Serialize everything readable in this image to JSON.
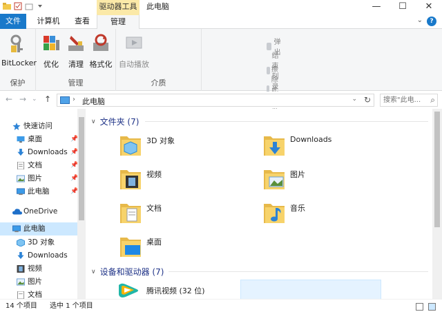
{
  "window": {
    "context_tab_header": "驱动器工具",
    "title": "此电脑",
    "controls": {
      "minimize": "—",
      "maximize": "☐",
      "close": "✕"
    }
  },
  "tabs": {
    "file": "文件",
    "computer": "计算机",
    "view": "查看",
    "manage": "管理",
    "help": "?"
  },
  "ribbon": {
    "protect": {
      "label": "保护",
      "bitlocker": "BitLocker"
    },
    "manage": {
      "label": "管理",
      "optimize": "优化",
      "cleanup": "清理",
      "format": "格式化"
    },
    "media": {
      "label": "介质",
      "autoplay": "自动播放",
      "eject": "弹出",
      "finish_burning": "结束刻录",
      "erase_disc": "擦除此光盘"
    }
  },
  "address": {
    "path": "此电脑",
    "search_placeholder": "搜索\"此电...",
    "icons": {
      "back": "←",
      "forward": "→",
      "recent": "⌄",
      "up": "↑",
      "refresh": "↻",
      "search": "⌕"
    }
  },
  "nav": {
    "quick_access": "快速访问",
    "items": [
      {
        "label": "桌面",
        "pinned": true
      },
      {
        "label": "Downloads",
        "pinned": true
      },
      {
        "label": "文档",
        "pinned": true
      },
      {
        "label": "图片",
        "pinned": true
      },
      {
        "label": "此电脑",
        "pinned": true
      }
    ],
    "onedrive": "OneDrive",
    "this_pc": "此电脑",
    "pc_items": [
      "3D 对象",
      "Downloads",
      "视频",
      "图片",
      "文档"
    ]
  },
  "main": {
    "folders_header": "文件夹 (7)",
    "folders": [
      {
        "name": "3D 对象",
        "icon": "3d-objects-folder-icon"
      },
      {
        "name": "Downloads",
        "icon": "downloads-folder-icon"
      },
      {
        "name": "视频",
        "icon": "videos-folder-icon"
      },
      {
        "name": "图片",
        "icon": "pictures-folder-icon"
      },
      {
        "name": "文档",
        "icon": "documents-folder-icon"
      },
      {
        "name": "音乐",
        "icon": "music-folder-icon"
      },
      {
        "name": "桌面",
        "icon": "desktop-folder-icon"
      }
    ],
    "devices_header": "设备和驱动器 (7)",
    "devices": [
      {
        "name": "腾讯视频 (32 位)",
        "icon": "tencent-video-icon"
      }
    ]
  },
  "status": {
    "count": "14 个项目",
    "selected": "选中 1 个项目"
  },
  "colors": {
    "accent": "#1979ca",
    "context_tab": "#fbe9a8",
    "selection": "#cce8ff",
    "section_header": "#1e3287",
    "folder": "#f7d36b"
  }
}
